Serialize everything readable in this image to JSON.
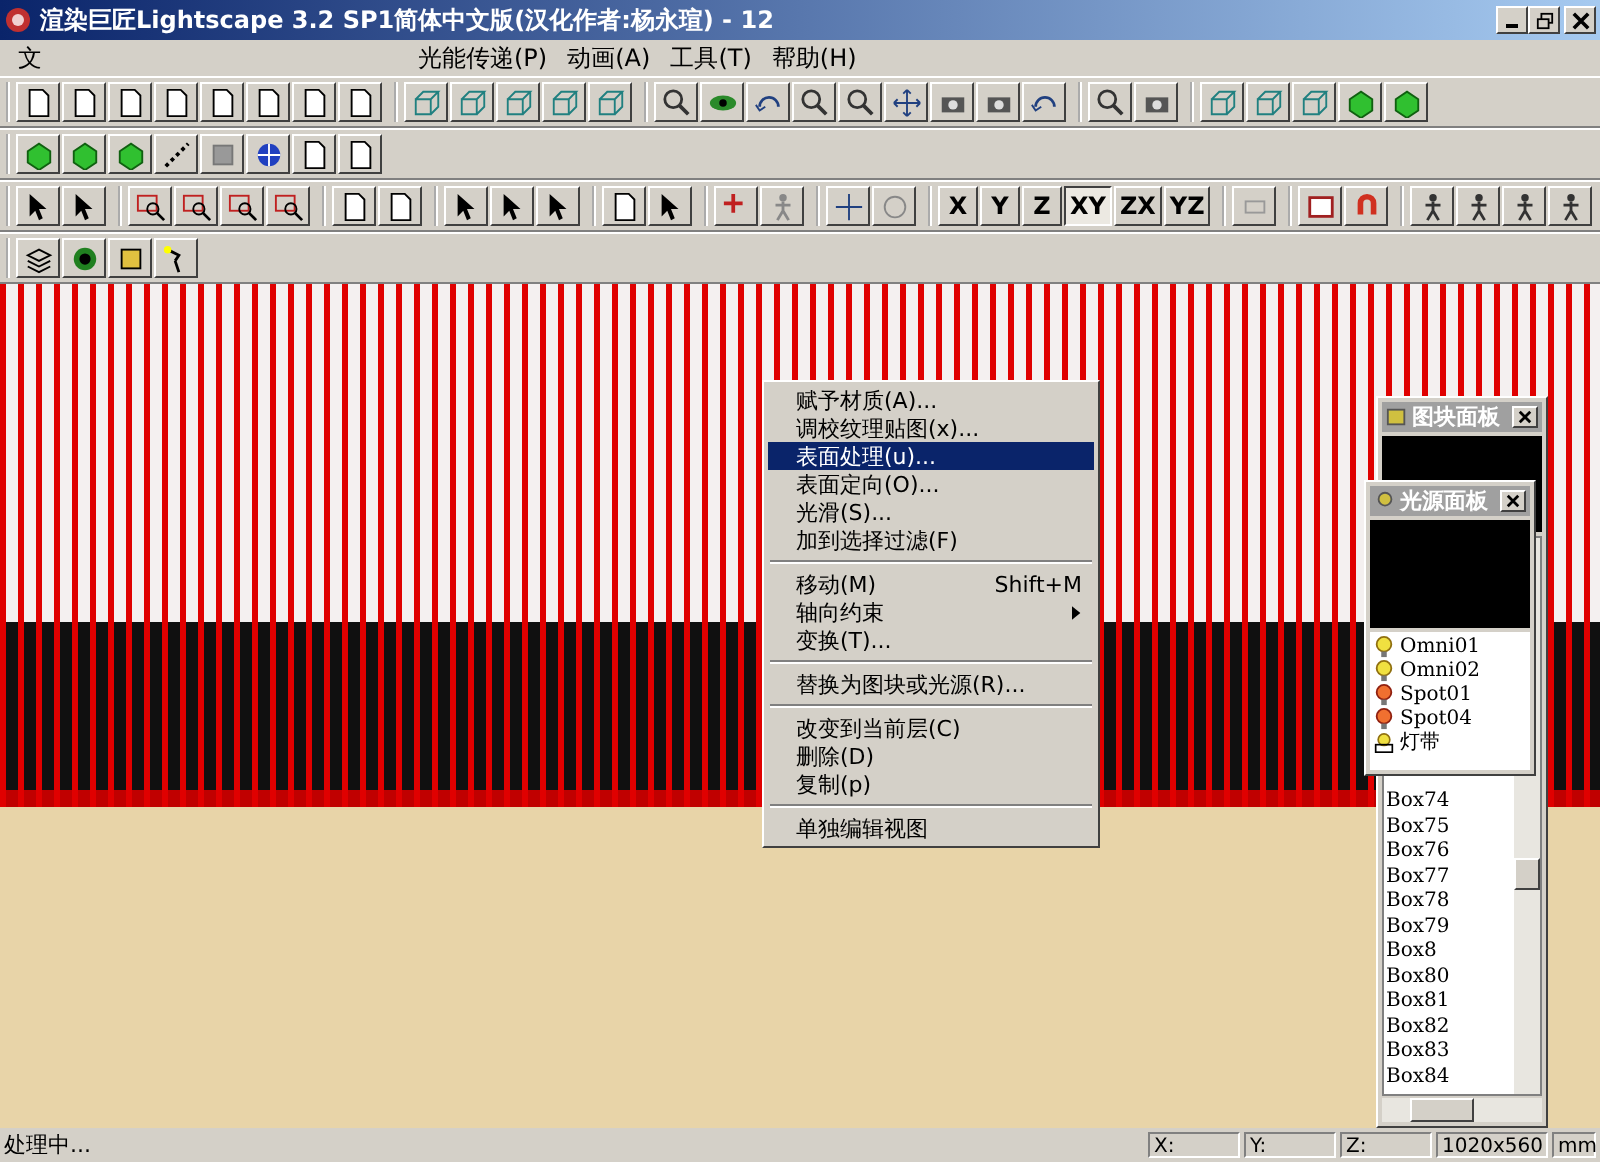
{
  "window": {
    "title": "渲染巨匠Lightscape 3.2 SP1简体中文版(汉化作者:杨永瑄) - 12"
  },
  "menu": [
    {
      "label": "文"
    },
    {
      "label": "光能传递(P)"
    },
    {
      "label": "动画(A)"
    },
    {
      "label": "工具(T)"
    },
    {
      "label": "帮助(H)"
    }
  ],
  "axis_buttons": [
    {
      "label": "X",
      "selected": false
    },
    {
      "label": "Y",
      "selected": false
    },
    {
      "label": "Z",
      "selected": false
    },
    {
      "label": "XY",
      "selected": true
    },
    {
      "label": "ZX",
      "selected": false
    },
    {
      "label": "YZ",
      "selected": false
    }
  ],
  "context_menu": [
    {
      "kind": "item",
      "label": "赋予材质(A)...",
      "selected": false
    },
    {
      "kind": "item",
      "label": "调校纹理贴图(x)...",
      "selected": false
    },
    {
      "kind": "item",
      "label": "表面处理(u)...",
      "selected": true
    },
    {
      "kind": "item",
      "label": "表面定向(O)...",
      "selected": false
    },
    {
      "kind": "item",
      "label": "光滑(S)...",
      "selected": false
    },
    {
      "kind": "item",
      "label": "加到选择过滤(F)",
      "selected": false
    },
    {
      "kind": "separator"
    },
    {
      "kind": "item",
      "label": "移动(M)",
      "shortcut": "Shift+M",
      "selected": false
    },
    {
      "kind": "item",
      "label": "轴向约束",
      "submenu": true,
      "selected": false
    },
    {
      "kind": "item",
      "label": "变换(T)...",
      "selected": false
    },
    {
      "kind": "separator"
    },
    {
      "kind": "item",
      "label": "替换为图块或光源(R)...",
      "selected": false
    },
    {
      "kind": "separator"
    },
    {
      "kind": "item",
      "label": "改变到当前层(C)",
      "selected": false
    },
    {
      "kind": "item",
      "label": "删除(D)",
      "selected": false
    },
    {
      "kind": "item",
      "label": "复制(p)",
      "selected": false
    },
    {
      "kind": "separator"
    },
    {
      "kind": "item",
      "label": "单独编辑视图",
      "selected": false
    }
  ],
  "block_panel": {
    "title": "图块面板",
    "items": [
      "Box74",
      "Box75",
      "Box76",
      "Box77",
      "Box78",
      "Box79",
      "Box8",
      "Box80",
      "Box81",
      "Box82",
      "Box83",
      "Box84"
    ]
  },
  "light_panel": {
    "title": "光源面板",
    "lights": [
      {
        "name": "Omni01",
        "kind": "omni"
      },
      {
        "name": "Omni02",
        "kind": "omni"
      },
      {
        "name": "Spot01",
        "kind": "spot"
      },
      {
        "name": "Spot04",
        "kind": "spot"
      },
      {
        "name": "灯带",
        "kind": "group"
      }
    ]
  },
  "status_bar": {
    "message": "处理中...",
    "x_label": "X:",
    "y_label": "Y:",
    "z_label": "Z:",
    "resolution": "1020x560",
    "unit": "mm"
  }
}
